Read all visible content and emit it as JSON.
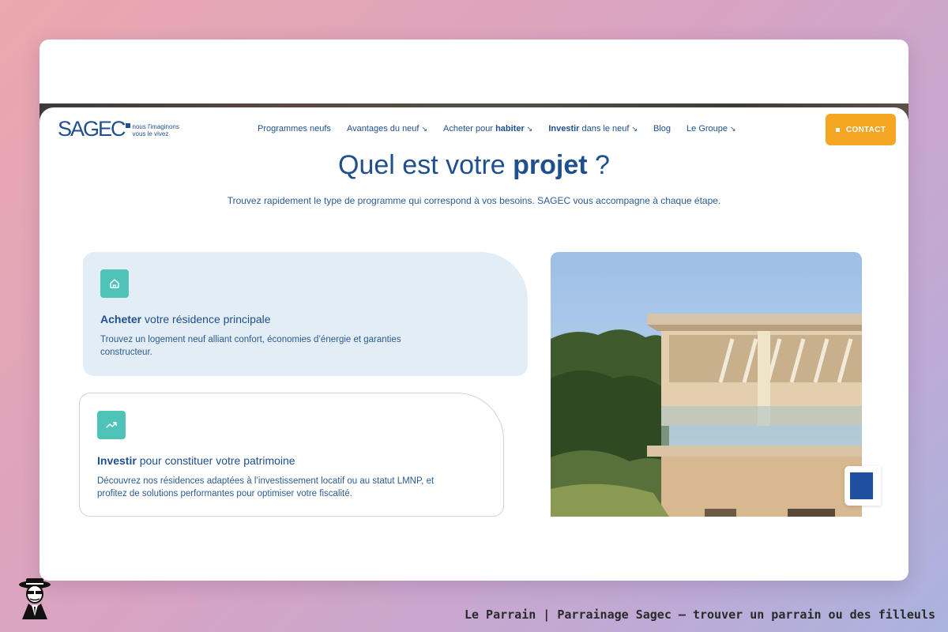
{
  "brand": {
    "logo_text": "SAGEC",
    "tagline_line1": "nous l'imaginons",
    "tagline_line2": "vous le vivez",
    "primary_color": "#1f4f8f",
    "accent_color": "#f5a623",
    "teal_color": "#4fc3b8"
  },
  "nav": {
    "items": [
      {
        "label": "Programmes neufs",
        "icon": ""
      },
      {
        "label": "Avantages du neuf",
        "icon": "chevron-down-icon"
      },
      {
        "pre": "Acheter pour ",
        "bold": "habiter",
        "icon": "chevron-down-icon"
      },
      {
        "bold": "Investir",
        "post": " dans le neuf",
        "icon": "chevron-down-icon"
      },
      {
        "label": "Blog",
        "icon": ""
      },
      {
        "label": "Le Groupe",
        "icon": "chevron-down-icon"
      }
    ],
    "contact_label": "CONTACT"
  },
  "main": {
    "title_regular": "Quel est votre ",
    "title_bold": "projet",
    "title_suffix": " ?",
    "subtitle": "Trouvez rapidement le type de programme qui correspond à vos besoins. SAGEC vous accompagne à chaque étape."
  },
  "cards": [
    {
      "icon": "home-icon",
      "title_bold": "Acheter",
      "title_rest": " votre résidence principale",
      "text": "Trouvez un logement neuf alliant confort, économies d’énergie et garanties constructeur."
    },
    {
      "icon": "trending-up-icon",
      "title_bold": "Investir",
      "title_rest": " pour constituer votre patrimoine",
      "text": "Découvrez nos résidences adaptées à l’investissement locatif ou au statut LMNP, et profitez de solutions performantes pour optimiser votre fiscalité."
    }
  ],
  "footer": {
    "caption": "Le Parrain | Parrainage Sagec — trouver un parrain ou des filleuls"
  }
}
